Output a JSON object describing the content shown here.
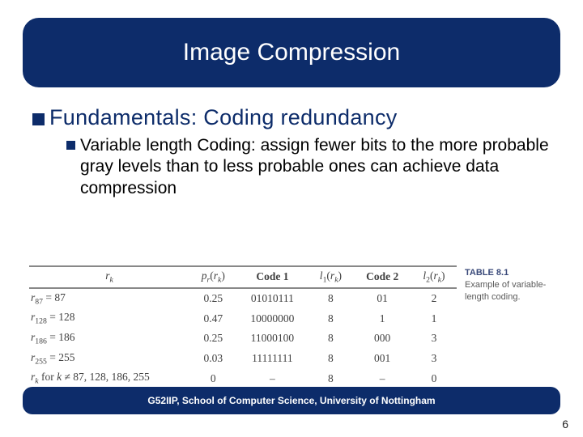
{
  "title": "Image Compression",
  "heading1": "Fundamentals: Coding redundancy",
  "heading2": "Variable length Coding: assign fewer bits to the more probable gray levels than to less probable ones can achieve data compression",
  "table": {
    "headers": [
      "rₖ",
      "pᵣ(rₖ)",
      "Code 1",
      "l₁(rₖ)",
      "Code 2",
      "l₂(rₖ)"
    ],
    "rows": [
      {
        "label": "r₈₇ = 87",
        "p": "0.25",
        "c1": "01010111",
        "l1": "8",
        "c2": "01",
        "l2": "2"
      },
      {
        "label": "r₁₂₈ = 128",
        "p": "0.47",
        "c1": "10000000",
        "l1": "8",
        "c2": "1",
        "l2": "1"
      },
      {
        "label": "r₁₈₆ = 186",
        "p": "0.25",
        "c1": "11000100",
        "l1": "8",
        "c2": "000",
        "l2": "3"
      },
      {
        "label": "r₂₅₅ = 255",
        "p": "0.03",
        "c1": "11111111",
        "l1": "8",
        "c2": "001",
        "l2": "3"
      },
      {
        "label": "rₖ for k ≠ 87, 128, 186, 255",
        "p": "0",
        "c1": "–",
        "l1": "8",
        "c2": "–",
        "l2": "0"
      }
    ]
  },
  "caption_label": "TABLE 8.1",
  "caption_body": "Example of variable-length coding.",
  "footer": "G52IIP, School of Computer Science, University of Nottingham",
  "page_number": "6"
}
